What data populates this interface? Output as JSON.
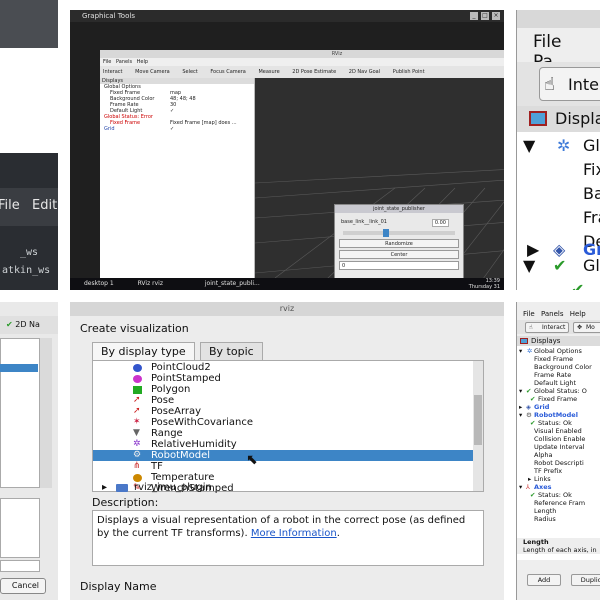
{
  "tile1": {
    "menu": [
      "File",
      "Edit"
    ],
    "terminal_lines": [
      "",
      "_ws",
      "atkin_ws"
    ]
  },
  "tile2": {
    "window_title": "Graphical Tools",
    "app_title": "RViz",
    "menu": [
      "File",
      "Panels",
      "Help"
    ],
    "toolbar": [
      "Interact",
      "Move Camera",
      "Select",
      "Focus Camera",
      "Measure",
      "2D Pose Estimate",
      "2D Nav Goal",
      "Publish Point"
    ],
    "displays_header": "Displays",
    "props": [
      {
        "name": "Global Options",
        "value": ""
      },
      {
        "name": "Fixed Frame",
        "value": "map"
      },
      {
        "name": "Background Color",
        "value": "48; 48; 48"
      },
      {
        "name": "Frame Rate",
        "value": "30"
      },
      {
        "name": "Default Light",
        "value": "✓"
      },
      {
        "name": "Global Status: Error",
        "value": ""
      },
      {
        "name": "Fixed Frame",
        "value": "Fixed Frame [map] does ..."
      },
      {
        "name": "Grid",
        "value": "✓"
      }
    ],
    "dialog": {
      "title": "joint_state_publisher",
      "joint_name": "base_link__link_01",
      "joint_value": "0.00",
      "randomize": "Randomize",
      "center": "Center",
      "spin_value": "0"
    },
    "taskbar": {
      "desktop": "desktop 1",
      "rviz": "RViz  rviz",
      "task": "joint_state_publi...",
      "time": "13:39",
      "day": "Thursday 31"
    }
  },
  "tile3": {
    "menu": [
      "File",
      "Pa"
    ],
    "interact": "Interact",
    "displays": "Displa",
    "rows": [
      "Glo",
      "Fix",
      "Ba",
      "Fra",
      "De",
      "Gl",
      "",
      "Gr"
    ]
  },
  "tile4": {
    "toolbar_label": "2D Na",
    "cancel": "Cancel"
  },
  "tile5": {
    "window_title": "rviz",
    "heading": "Create visualization",
    "tabs": [
      "By display type",
      "By topic"
    ],
    "items": [
      {
        "label": "PointCloud2",
        "color": "#3355cc"
      },
      {
        "label": "PointStamped",
        "color": "#cc33cc"
      },
      {
        "label": "Polygon",
        "color": "#22aa22"
      },
      {
        "label": "Pose",
        "color": "#cc2222"
      },
      {
        "label": "PoseArray",
        "color": "#cc2222"
      },
      {
        "label": "PoseWithCovariance",
        "color": "#cc2244"
      },
      {
        "label": "Range",
        "color": "#888888"
      },
      {
        "label": "RelativeHumidity",
        "color": "#8833cc"
      },
      {
        "label": "RobotModel",
        "color": "#555555"
      },
      {
        "label": "TF",
        "color": "#cc3333"
      },
      {
        "label": "Temperature",
        "color": "#cc8800"
      },
      {
        "label": "WrenchStamped",
        "color": "#cc2222"
      },
      {
        "label": "rviz_imu_plugin",
        "color": "#4a78c8"
      }
    ],
    "selected": "RobotModel",
    "desc_label": "Description:",
    "desc_text": "Displays a visual representation of a robot in the correct pose (as defined by the current TF transforms).",
    "desc_link": "More Information",
    "display_name_label": "Display Name"
  },
  "tile6": {
    "menu": [
      "File",
      "Panels",
      "Help"
    ],
    "interact": "Interact",
    "mo": "Mo",
    "displays": "Displays",
    "rows": [
      "Global Options",
      "Fixed Frame",
      "Background Color",
      "Frame Rate",
      "Default Light",
      "Global Status: O",
      "Fixed Frame",
      "Grid",
      "RobotModel",
      "Status: Ok",
      "Visual Enabled",
      "Collision Enable",
      "Update Interval",
      "Alpha",
      "Robot Descripti",
      "TF Prefix",
      "Links",
      "Axes",
      "Status: Ok",
      "Reference Fram",
      "Length",
      "Radius"
    ],
    "footer_title": "Length",
    "footer_text": "Length of each axis, in",
    "add": "Add",
    "dup": "Duplic"
  },
  "colors": {
    "selection": "#3d85c6",
    "link": "#1a55c8",
    "viewport": "#2f2f2f"
  }
}
